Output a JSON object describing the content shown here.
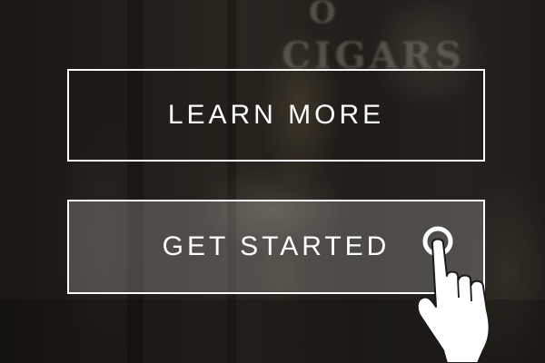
{
  "buttons": {
    "learn_more_label": "LEARN MORE",
    "get_started_label": "GET STARTED"
  },
  "background": {
    "sign_line_1": "O",
    "sign_line_2": "CIGARS"
  },
  "icons": {
    "pointer": "tap-hand-icon"
  },
  "colors": {
    "button_border": "#ffffff",
    "button_text": "#ffffff"
  }
}
